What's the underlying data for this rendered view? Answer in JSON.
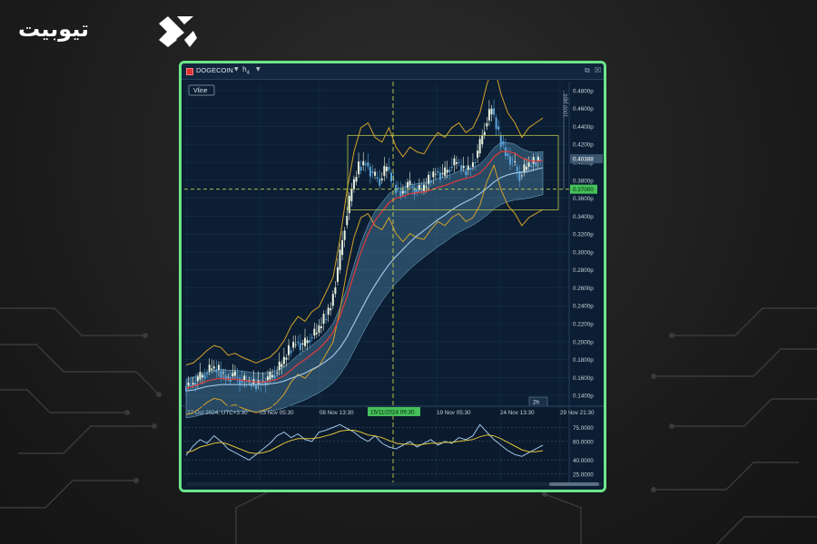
{
  "brand": {
    "logo_text": "تیوبیت",
    "colors": {
      "accent": "#6ce68a",
      "background": "#1c1c1c",
      "chart_bg": "#0c1e33"
    }
  },
  "window": {
    "symbol": "DOGECOIN",
    "timeframe": "h",
    "timeframe_sub": "4",
    "icons": [
      "chart-type-icon",
      "popout-icon",
      "close-icon"
    ]
  },
  "toolbar": {
    "vline_label": "Vline"
  },
  "main_axis": {
    "price_ticks": [
      "0.4800p",
      "0.4600p",
      "0.4400p",
      "0.4200p",
      "0.4000p",
      "0.3800p",
      "0.3600p",
      "0.3400p",
      "0.3200p",
      "0.3000p",
      "0.2800p",
      "0.2600p",
      "0.2400p",
      "0.2200p",
      "0.2000p",
      "0.1800p",
      "0.1600p",
      "0.1400p"
    ],
    "current_price": "0.40388",
    "crosshair_price": "0.37000",
    "pips_label": "1000 pips",
    "time_ticks": [
      "27 Oct 2024, UTC+3:30",
      "03 Nov 05:30",
      "08 Nov 13:30",
      "19 Nov 05:30",
      "24 Nov 13:30",
      "29 Nov 21:30"
    ],
    "crosshair_time": "15/11/2024 09:30",
    "period_label": "2h"
  },
  "oscillator": {
    "ticks": [
      "75.0000",
      "60.0000",
      "40.0000",
      "25.0000"
    ]
  },
  "chart_data": {
    "type": "line",
    "title": "",
    "ylim": [
      0.13,
      0.49
    ],
    "series": [
      {
        "values": [
          0.15,
          0.152,
          0.158,
          0.165,
          0.17,
          0.168,
          0.16,
          0.162,
          0.158,
          0.155,
          0.152,
          0.155,
          0.158,
          0.165,
          0.175,
          0.19,
          0.2,
          0.195,
          0.205,
          0.21,
          0.225,
          0.24,
          0.28,
          0.33,
          0.37,
          0.395,
          0.4,
          0.385,
          0.38,
          0.395,
          0.375,
          0.365,
          0.375,
          0.37,
          0.368,
          0.38,
          0.39,
          0.385,
          0.395,
          0.4,
          0.39,
          0.395,
          0.41,
          0.44,
          0.46,
          0.43,
          0.41,
          0.4,
          0.385,
          0.395,
          0.4,
          0.405
        ]
      },
      {
        "values": [
          0.148,
          0.15,
          0.153,
          0.156,
          0.158,
          0.159,
          0.158,
          0.158,
          0.157,
          0.156,
          0.155,
          0.155,
          0.156,
          0.158,
          0.162,
          0.168,
          0.175,
          0.18,
          0.186,
          0.192,
          0.2,
          0.21,
          0.228,
          0.25,
          0.275,
          0.3,
          0.32,
          0.335,
          0.345,
          0.355,
          0.36,
          0.362,
          0.365,
          0.366,
          0.367,
          0.369,
          0.372,
          0.374,
          0.377,
          0.38,
          0.382,
          0.384,
          0.388,
          0.396,
          0.406,
          0.412,
          0.412,
          0.41,
          0.405,
          0.402,
          0.401,
          0.402
        ]
      },
      {
        "values": [
          0.145,
          0.146,
          0.148,
          0.15,
          0.151,
          0.152,
          0.152,
          0.152,
          0.152,
          0.152,
          0.152,
          0.152,
          0.153,
          0.154,
          0.156,
          0.159,
          0.162,
          0.165,
          0.169,
          0.173,
          0.178,
          0.184,
          0.193,
          0.205,
          0.22,
          0.235,
          0.25,
          0.263,
          0.275,
          0.286,
          0.295,
          0.303,
          0.311,
          0.318,
          0.324,
          0.33,
          0.336,
          0.341,
          0.347,
          0.352,
          0.356,
          0.36,
          0.365,
          0.371,
          0.378,
          0.383,
          0.386,
          0.388,
          0.389,
          0.39,
          0.392,
          0.394
        ]
      }
    ],
    "oscillator": {
      "ylim": [
        20,
        90
      ],
      "series": [
        {
          "values": [
            45,
            55,
            62,
            58,
            66,
            60,
            52,
            48,
            44,
            40,
            46,
            52,
            58,
            66,
            70,
            64,
            68,
            62,
            60,
            70,
            72,
            75,
            78,
            74,
            70,
            64,
            60,
            66,
            58,
            54,
            52,
            56,
            60,
            54,
            58,
            62,
            56,
            60,
            58,
            64,
            62,
            66,
            78,
            70,
            62,
            56,
            50,
            46,
            44,
            48,
            52,
            56
          ]
        },
        {
          "values": [
            48,
            50,
            54,
            56,
            58,
            59,
            57,
            54,
            51,
            48,
            47,
            48,
            50,
            54,
            58,
            61,
            63,
            63,
            63,
            64,
            66,
            68,
            71,
            72,
            72,
            70,
            67,
            66,
            64,
            61,
            58,
            57,
            57,
            56,
            57,
            58,
            58,
            59,
            59,
            60,
            61,
            62,
            65,
            67,
            66,
            63,
            59,
            55,
            51,
            49,
            49,
            50
          ]
        }
      ]
    }
  }
}
